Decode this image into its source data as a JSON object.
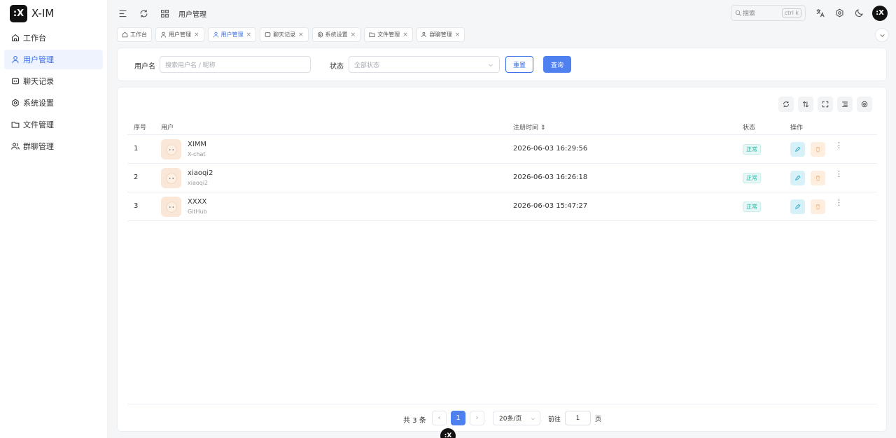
{
  "app": {
    "logo_glyph": ":X",
    "name": "X-IM"
  },
  "sidebar": {
    "items": [
      {
        "label": "工作台",
        "icon": "home-icon",
        "active": false
      },
      {
        "label": "用户管理",
        "icon": "user-icon",
        "active": true
      },
      {
        "label": "聊天记录",
        "icon": "chat-icon",
        "active": false
      },
      {
        "label": "系统设置",
        "icon": "gear-icon",
        "active": false
      },
      {
        "label": "文件管理",
        "icon": "folder-icon",
        "active": false
      },
      {
        "label": "群聊管理",
        "icon": "users-icon",
        "active": false
      }
    ]
  },
  "header": {
    "breadcrumb": "用户管理",
    "search_placeholder": "搜索",
    "search_shortcut": "ctrl k",
    "avatar_glyph": ":X"
  },
  "tabs": [
    {
      "label": "工作台",
      "icon": "home-icon",
      "closable": false,
      "active": false
    },
    {
      "label": "用户管理",
      "icon": "user-icon",
      "closable": true,
      "active": false
    },
    {
      "label": "用户管理",
      "icon": "user-icon",
      "closable": true,
      "active": true
    },
    {
      "label": "聊天记录",
      "icon": "chat-icon",
      "closable": true,
      "active": false
    },
    {
      "label": "系统设置",
      "icon": "gear-icon",
      "closable": true,
      "active": false
    },
    {
      "label": "文件管理",
      "icon": "folder-icon",
      "closable": true,
      "active": false
    },
    {
      "label": "群聊管理",
      "icon": "users-icon",
      "closable": true,
      "active": false
    }
  ],
  "filter": {
    "username_label": "用户名",
    "username_placeholder": "搜索用户名 / 昵称",
    "status_label": "状态",
    "status_value": "全部状态",
    "reset_label": "重置",
    "query_label": "查询"
  },
  "table": {
    "columns": {
      "index": "序号",
      "user": "用户",
      "reg_time": "注册时间",
      "status": "状态",
      "actions": "操作"
    },
    "rows": [
      {
        "index": "1",
        "name": "XIMM",
        "sub": "X-chat",
        "reg_time": "2026-06-03 16:29:56",
        "status": "正常"
      },
      {
        "index": "2",
        "name": "xiaoqi2",
        "sub": "xiaoqi2",
        "reg_time": "2026-06-03 16:26:18",
        "status": "正常"
      },
      {
        "index": "3",
        "name": "XXXX",
        "sub": "GitHub",
        "reg_time": "2026-06-03 15:47:27",
        "status": "正常"
      }
    ]
  },
  "pagination": {
    "total_text": "共 3 条",
    "current_page": "1",
    "page_size": "20条/页",
    "goto_label": "前往",
    "goto_value": "1",
    "page_suffix": "页"
  },
  "colors": {
    "accent": "#4f80ef",
    "status_ok": "#27b5a6"
  }
}
